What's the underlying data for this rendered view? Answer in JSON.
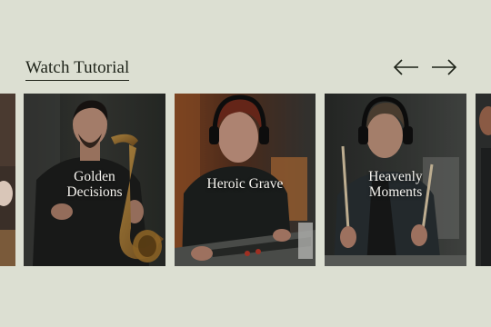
{
  "section": {
    "title": "Watch Tutorial"
  },
  "carousel": {
    "prev_icon": "arrow-left-icon",
    "next_icon": "arrow-right-icon",
    "cards": [
      {
        "title": "Golden\nDecisions",
        "subject": "saxophone-player-photo"
      },
      {
        "title": "Heroic Grave",
        "subject": "mixing-engineer-photo"
      },
      {
        "title": "Heavenly\nMoments",
        "subject": "drummer-photo"
      }
    ]
  },
  "colors": {
    "background": "#dcdfd2",
    "text": "#1d2218",
    "caption": "#f5f3ee"
  }
}
